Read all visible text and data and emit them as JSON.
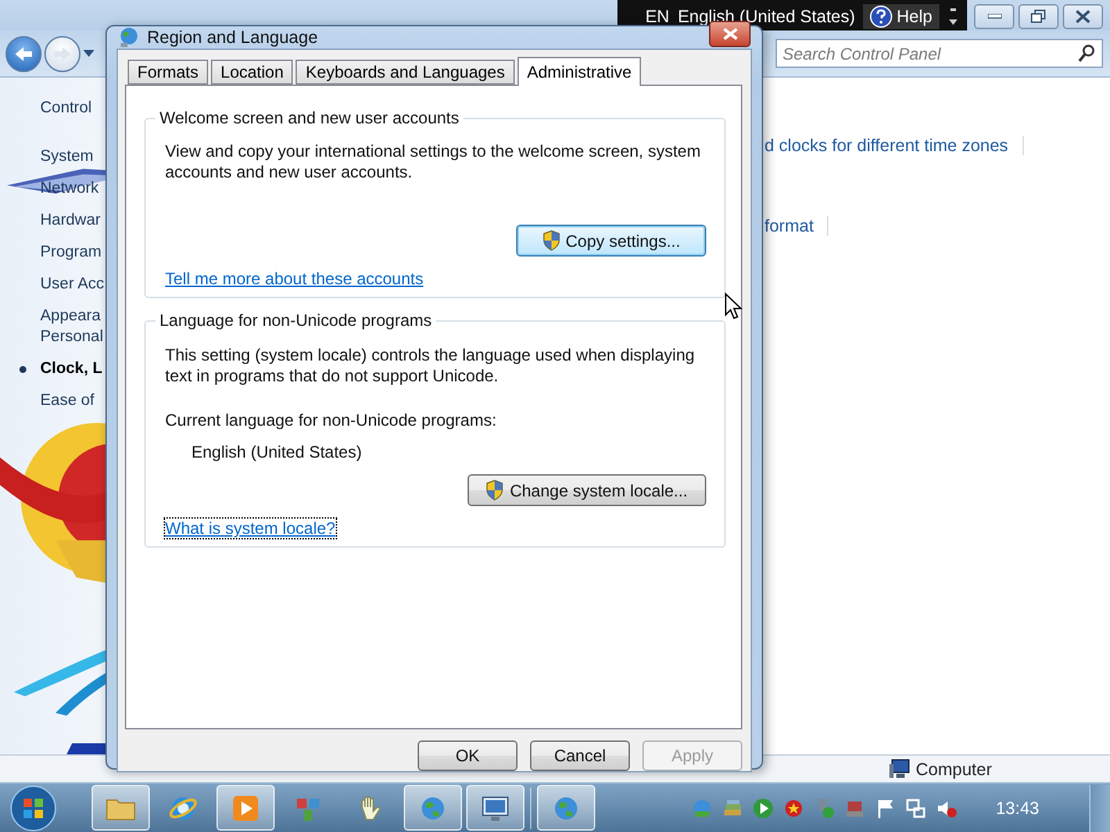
{
  "explorer": {
    "sidebar": {
      "heading": "Control",
      "items": [
        {
          "label": "System",
          "selected": false
        },
        {
          "label": "Network",
          "selected": false
        },
        {
          "label": "Hardwar",
          "selected": false
        },
        {
          "label": "Program",
          "selected": false
        },
        {
          "label": "User Acc",
          "selected": false
        },
        {
          "label": "Appeara\nPersonal",
          "selected": false
        },
        {
          "label": "Clock, L",
          "selected": true
        },
        {
          "label": "Ease of",
          "selected": false
        }
      ]
    },
    "content_links": [
      "d clocks for different time zones",
      "format"
    ],
    "search": {
      "placeholder": "Search Control Panel"
    },
    "status_bar": {
      "label": "Computer"
    }
  },
  "language_bar": {
    "code": "EN",
    "language": "English (United States)",
    "help": "Help"
  },
  "dialog": {
    "title": "Region and Language",
    "tabs": [
      {
        "label": "Formats",
        "selected": false
      },
      {
        "label": "Location",
        "selected": false
      },
      {
        "label": "Keyboards and Languages",
        "selected": false
      },
      {
        "label": "Administrative",
        "selected": true
      }
    ],
    "welcome": {
      "title": "Welcome screen and new user accounts",
      "text": "View and copy your international settings to the welcome screen, system accounts and new user accounts.",
      "button": "Copy settings...",
      "link": "Tell me more about these accounts"
    },
    "non_unicode": {
      "title": "Language for non-Unicode programs",
      "text": "This setting (system locale) controls the language used when displaying text in programs that do not support Unicode.",
      "current_label": "Current language for non-Unicode programs:",
      "current_value": "English (United States)",
      "button": "Change system locale...",
      "link": "What is system locale?"
    },
    "buttons": [
      {
        "label": "OK",
        "disabled": false
      },
      {
        "label": "Cancel",
        "disabled": false
      },
      {
        "label": "Apply",
        "disabled": true
      }
    ]
  },
  "taskbar": {
    "apps": [
      {
        "running": true
      },
      {
        "running": false
      },
      {
        "running": true
      },
      {
        "running": false
      },
      {
        "running": false
      },
      {
        "running": true
      },
      {
        "running": true
      },
      {
        "running": true
      }
    ],
    "clock": "13:43"
  }
}
